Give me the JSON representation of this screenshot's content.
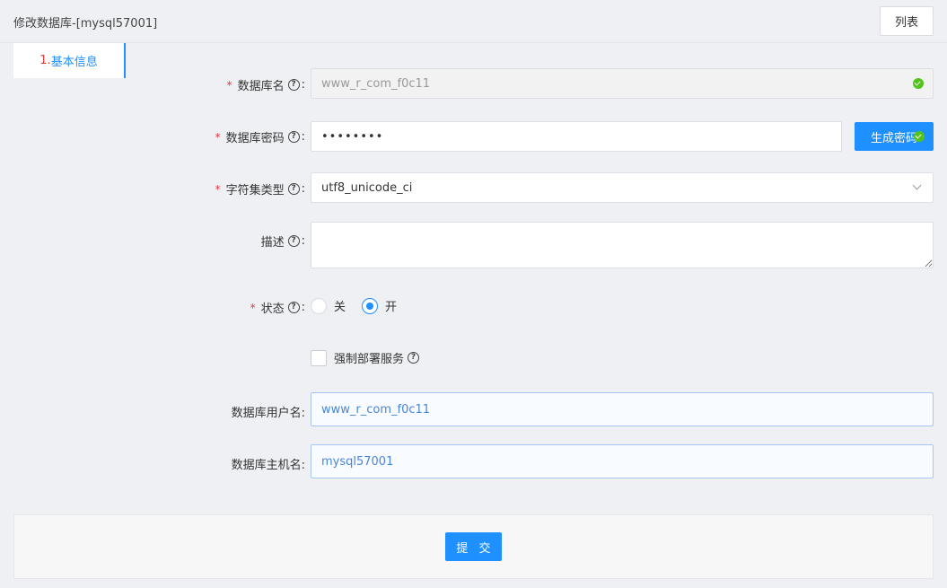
{
  "header": {
    "title": "修改数据库-[mysql57001]",
    "list_button": "列表"
  },
  "tab": {
    "num": "1.",
    "label": "基本信息"
  },
  "form": {
    "db_name": {
      "label": "数据库名",
      "value": "www_r_com_f0c11",
      "required": true
    },
    "db_password": {
      "label": "数据库密码",
      "value": "••••••••",
      "required": true,
      "generate_button": "生成密码"
    },
    "charset": {
      "label": "字符集类型",
      "value": "utf8_unicode_ci",
      "required": true
    },
    "description": {
      "label": "描述",
      "value": ""
    },
    "status": {
      "label": "状态",
      "required": true,
      "options": [
        "关",
        "开"
      ],
      "selected": "开"
    },
    "force_deploy": {
      "label": "强制部署服务",
      "checked": false
    },
    "db_username": {
      "label": "数据库用户名:",
      "value": "www_r_com_f0c11"
    },
    "db_host": {
      "label": "数据库主机名:",
      "value": "mysql57001"
    }
  },
  "footer": {
    "submit_button": "提 交"
  },
  "colors": {
    "primary": "#1e90ff",
    "required": "#e4393c",
    "success": "#52c41a"
  }
}
